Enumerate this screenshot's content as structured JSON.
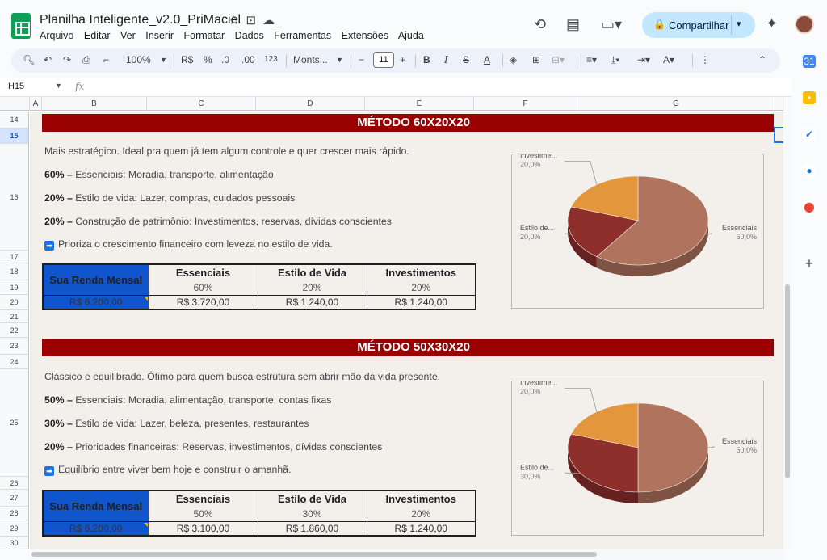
{
  "header": {
    "doc_title": "Planilha Inteligente_v2.0_PriMaciel",
    "menu": [
      "Arquivo",
      "Editar",
      "Ver",
      "Inserir",
      "Formatar",
      "Dados",
      "Ferramentas",
      "Extensões",
      "Ajuda"
    ],
    "share_label": "Compartilhar"
  },
  "toolbar": {
    "zoom": "100%",
    "currency": "R$",
    "percent": "%",
    "dec_less": ".0",
    "dec_more": ".00",
    "number_format": "123",
    "font_name": "Monts...",
    "font_size": "11"
  },
  "formula_bar": {
    "cell_ref": "H15",
    "fx": "fx"
  },
  "columns": [
    "A",
    "B",
    "C",
    "D",
    "E",
    "F",
    "G"
  ],
  "rows": [
    "14",
    "15",
    "16",
    "17",
    "18",
    "19",
    "20",
    "21",
    "22",
    "23",
    "24",
    "25",
    "26",
    "27",
    "28",
    "29",
    "30"
  ],
  "selected_row": "15",
  "sections": [
    {
      "banner": "MÉTODO 60X20X20",
      "intro": "Mais estratégico. Ideal pra quem já tem algum controle e quer crescer mais rápido.",
      "items": [
        {
          "pct": "60% –",
          "text": " Essenciais: Moradia, transporte, alimentação"
        },
        {
          "pct": "20% –",
          "text": " Estilo de vida: Lazer, compras, cuidados pessoais"
        },
        {
          "pct": "20% –",
          "text": " Construção de patrimônio: Investimentos, reservas, dívidas conscientes"
        }
      ],
      "note": "Prioriza o crescimento financeiro com leveza no estilo de vida.",
      "table": {
        "renda_label": "Sua Renda Mensal",
        "headers": [
          "Essenciais",
          "Estilo de Vida",
          "Investimentos"
        ],
        "percents": [
          "60%",
          "20%",
          "20%"
        ],
        "renda_value": "R$ 6.200,00",
        "values": [
          "R$ 3.720,00",
          "R$ 1.240,00",
          "R$ 1.240,00"
        ]
      },
      "chart_data": {
        "type": "pie",
        "series": [
          {
            "name": "Essenciais",
            "value": 60.0,
            "label": "60,0%",
            "color": "#b0735e"
          },
          {
            "name": "Estilo de...",
            "value": 20.0,
            "label": "20,0%",
            "color": "#8e2f2c"
          },
          {
            "name": "Investime...",
            "value": 20.0,
            "label": "20,0%",
            "color": "#e3963c"
          }
        ]
      }
    },
    {
      "banner": "MÉTODO 50X30X20",
      "intro": "Clássico e equilibrado. Ótimo para quem busca estrutura sem abrir mão da vida presente.",
      "items": [
        {
          "pct": "50% –",
          "text": " Essenciais: Moradia, alimentação, transporte, contas fixas"
        },
        {
          "pct": "30% –",
          "text": " Estilo de vida: Lazer, beleza, presentes, restaurantes"
        },
        {
          "pct": "20% –",
          "text": " Prioridades financeiras: Reservas, investimentos, dívidas conscientes"
        }
      ],
      "note": "Equilíbrio entre viver bem hoje e construir o amanhã.",
      "table": {
        "renda_label": "Sua Renda Mensal",
        "headers": [
          "Essenciais",
          "Estilo de Vida",
          "Investimentos"
        ],
        "percents": [
          "50%",
          "30%",
          "20%"
        ],
        "renda_value": "R$ 6.200,00",
        "values": [
          "R$ 3.100,00",
          "R$ 1.860,00",
          "R$ 1.240,00"
        ]
      },
      "chart_data": {
        "type": "pie",
        "series": [
          {
            "name": "Essenciais",
            "value": 50.0,
            "label": "50,0%",
            "color": "#b0735e"
          },
          {
            "name": "Estilo de...",
            "value": 30.0,
            "label": "30,0%",
            "color": "#8e2f2c"
          },
          {
            "name": "Investime...",
            "value": 20.0,
            "label": "20,0%",
            "color": "#e3963c"
          }
        ]
      }
    }
  ]
}
